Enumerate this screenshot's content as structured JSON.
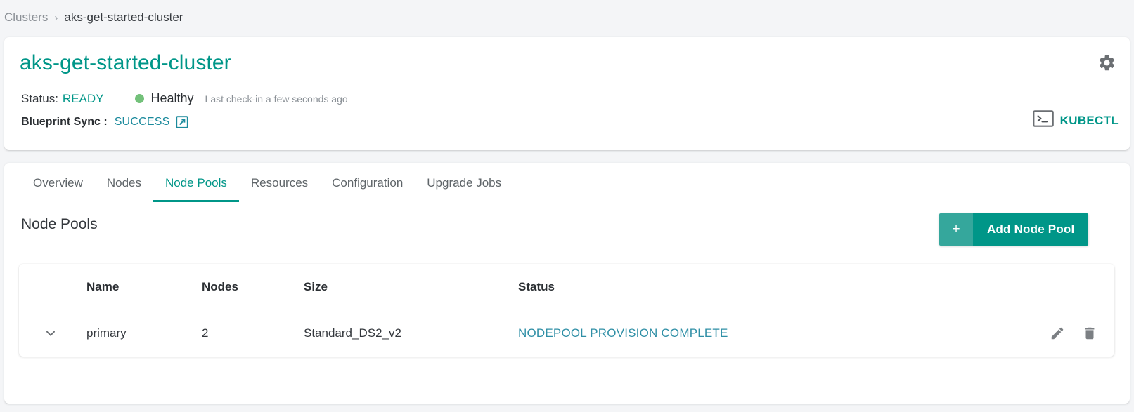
{
  "breadcrumb": {
    "root": "Clusters",
    "separator": "›",
    "current": "aks-get-started-cluster"
  },
  "header": {
    "title": "aks-get-started-cluster",
    "status_label": "Status:",
    "status_value": "READY",
    "health_text": "Healthy",
    "health_dot_color": "#73c17a",
    "checkin_text": "Last check-in a few seconds ago",
    "sync_label": "Blueprint Sync :",
    "sync_value": "SUCCESS",
    "external_link_icon": "external-link-icon",
    "gear_icon": "gear-icon",
    "kubectl_icon": "terminal-icon",
    "kubectl_label": "KUBECTL",
    "accent_color": "#009688",
    "link_color": "#1b8a9c"
  },
  "tabs": [
    {
      "label": "Overview",
      "active": false
    },
    {
      "label": "Nodes",
      "active": false
    },
    {
      "label": "Node Pools",
      "active": true
    },
    {
      "label": "Resources",
      "active": false
    },
    {
      "label": "Configuration",
      "active": false
    },
    {
      "label": "Upgrade Jobs",
      "active": false
    }
  ],
  "section": {
    "title": "Node Pools",
    "add_button_plus": "+",
    "add_button_label": "Add Node Pool",
    "add_button_color": "#009688",
    "add_button_plus_color": "#35a79c"
  },
  "table": {
    "columns": [
      "Name",
      "Nodes",
      "Size",
      "Status"
    ],
    "rows": [
      {
        "expand_icon": "chevron-down-icon",
        "name": "primary",
        "nodes": "2",
        "size": "Standard_DS2_v2",
        "status": "NODEPOOL PROVISION COMPLETE",
        "status_color": "#2f8fa6",
        "edit_icon": "pencil-icon",
        "delete_icon": "trash-icon"
      }
    ]
  }
}
